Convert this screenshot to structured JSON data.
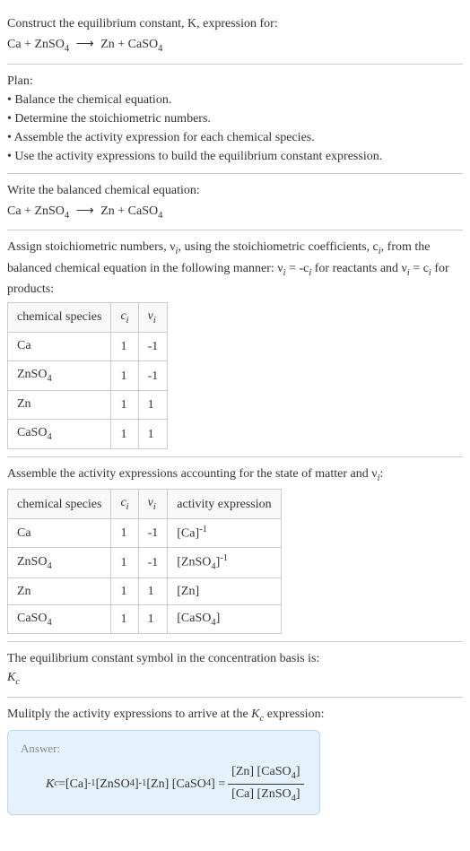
{
  "intro": {
    "line1": "Construct the equilibrium constant, K, expression for:",
    "equation_left_1": "Ca + ZnSO",
    "equation_left_sub": "4",
    "arrow": "⟶",
    "equation_right_1": "Zn + CaSO",
    "equation_right_sub": "4"
  },
  "plan": {
    "heading": "Plan:",
    "items": [
      "Balance the chemical equation.",
      "Determine the stoichiometric numbers.",
      "Assemble the activity expression for each chemical species.",
      "Use the activity expressions to build the equilibrium constant expression."
    ]
  },
  "balanced": {
    "heading": "Write the balanced chemical equation:",
    "left_1": "Ca + ZnSO",
    "left_sub": "4",
    "arrow": "⟶",
    "right_1": "Zn + CaSO",
    "right_sub": "4"
  },
  "stoich": {
    "heading_1": "Assign stoichiometric numbers, ν",
    "heading_sub1": "i",
    "heading_2": ", using the stoichiometric coefficients, c",
    "heading_sub2": "i",
    "heading_3": ", from the balanced chemical equation in the following manner: ν",
    "heading_sub3": "i",
    "heading_4": " = -c",
    "heading_sub4": "i",
    "heading_5": " for reactants and ν",
    "heading_sub5": "i",
    "heading_6": " = c",
    "heading_sub6": "i",
    "heading_7": " for products:",
    "table": {
      "headers": {
        "species": "chemical species",
        "ci": "c",
        "ci_sub": "i",
        "vi": "ν",
        "vi_sub": "i"
      },
      "rows": [
        {
          "species": "Ca",
          "species_sub": "",
          "ci": "1",
          "vi": "-1"
        },
        {
          "species": "ZnSO",
          "species_sub": "4",
          "ci": "1",
          "vi": "-1"
        },
        {
          "species": "Zn",
          "species_sub": "",
          "ci": "1",
          "vi": "1"
        },
        {
          "species": "CaSO",
          "species_sub": "4",
          "ci": "1",
          "vi": "1"
        }
      ]
    }
  },
  "activity": {
    "heading_1": "Assemble the activity expressions accounting for the state of matter and ν",
    "heading_sub": "i",
    "heading_2": ":",
    "table": {
      "headers": {
        "species": "chemical species",
        "ci": "c",
        "ci_sub": "i",
        "vi": "ν",
        "vi_sub": "i",
        "act": "activity expression"
      },
      "rows": [
        {
          "species": "Ca",
          "species_sub": "",
          "ci": "1",
          "vi": "-1",
          "act_base": "[Ca]",
          "act_sub": "",
          "act_sup": "-1"
        },
        {
          "species": "ZnSO",
          "species_sub": "4",
          "ci": "1",
          "vi": "-1",
          "act_base": "[ZnSO",
          "act_sub": "4",
          "act_close": "]",
          "act_sup": "-1"
        },
        {
          "species": "Zn",
          "species_sub": "",
          "ci": "1",
          "vi": "1",
          "act_base": "[Zn]",
          "act_sub": "",
          "act_sup": ""
        },
        {
          "species": "CaSO",
          "species_sub": "4",
          "ci": "1",
          "vi": "1",
          "act_base": "[CaSO",
          "act_sub": "4",
          "act_close": "]",
          "act_sup": ""
        }
      ]
    }
  },
  "symbol": {
    "line1": "The equilibrium constant symbol in the concentration basis is:",
    "kc": "K",
    "kc_sub": "c"
  },
  "multiply": {
    "line_1": "Mulitply the activity expressions to arrive at the ",
    "kc": "K",
    "kc_sub": "c",
    "line_2": " expression:"
  },
  "answer": {
    "label": "Answer:",
    "kc": "K",
    "kc_sub": "c",
    "eq": " = ",
    "t1": "[Ca]",
    "sup1": "-1",
    "t2": " [ZnSO",
    "t2_sub": "4",
    "t2_close": "]",
    "sup2": "-1",
    "t3": " [Zn] [CaSO",
    "t3_sub": "4",
    "t3_close": "] = ",
    "num_1": "[Zn] [CaSO",
    "num_sub": "4",
    "num_close": "]",
    "den_1": "[Ca] [ZnSO",
    "den_sub": "4",
    "den_close": "]"
  }
}
